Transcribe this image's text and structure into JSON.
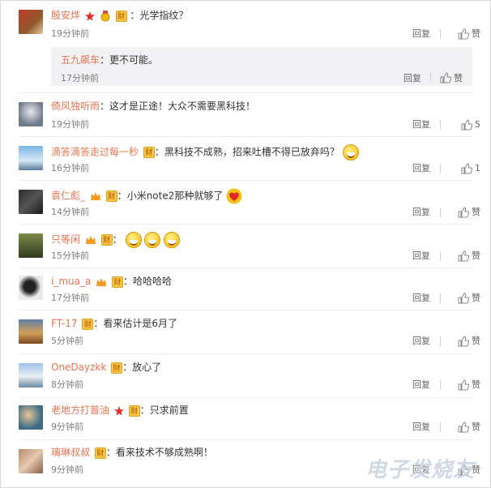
{
  "comments": [
    {
      "user": "殷安烨",
      "text": "光学指纹？",
      "time": "19分钟前",
      "reply": "回复",
      "like": "赞",
      "badges": [
        "vip-red",
        "medal",
        "cai"
      ],
      "sub": {
        "user": "五九飙车",
        "text": "更不可能。",
        "time": "17分钟前",
        "reply": "回复",
        "like": "赞"
      }
    },
    {
      "user": "倚风独听雨",
      "text": "这才是正途！大众不需要黑科技！",
      "time": "19分钟前",
      "reply": "回复",
      "like": "5",
      "badges": []
    },
    {
      "user": "滴答滴答走过每一秒",
      "text": "黑科技不成熟，招来吐槽不得已放弃吗？",
      "time": "16分钟前",
      "reply": "回复",
      "like": "1",
      "badges": [
        "cai"
      ],
      "emoji": [
        "laugh"
      ]
    },
    {
      "user": "袁仁彪_",
      "text": "小米note2那种就够了",
      "time": "14分钟前",
      "reply": "回复",
      "like": "赞",
      "badges": [
        "vip-orange",
        "cai"
      ],
      "emoji": [
        "heart"
      ]
    },
    {
      "user": "只等闲",
      "text": "",
      "time": "15分钟前",
      "reply": "回复",
      "like": "赞",
      "badges": [
        "vip-orange",
        "cai"
      ],
      "emoji": [
        "laugh",
        "laugh",
        "laugh"
      ]
    },
    {
      "user": "i_mua_a",
      "text": "哈哈哈哈",
      "time": "17分钟前",
      "reply": "回复",
      "like": "赞",
      "badges": [
        "vip-orange",
        "cai"
      ]
    },
    {
      "user": "FT-17",
      "text": "看来估计是6月了",
      "time": "5分钟前",
      "reply": "回复",
      "like": "赞",
      "badges": [
        "cai"
      ]
    },
    {
      "user": "OneDayzkk",
      "text": "放心了",
      "time": "8分钟前",
      "reply": "回复",
      "like": "赞",
      "badges": [
        "cai"
      ]
    },
    {
      "user": "老地方打普油",
      "text": "只求前置",
      "time": "9分钟前",
      "reply": "回复",
      "like": "赞",
      "badges": [
        "vip-red",
        "cai"
      ]
    },
    {
      "user": "璃琳叔叔",
      "text": "看来技术不够成熟啊！",
      "time": "9分钟前",
      "reply": "回复",
      "like": "赞",
      "badges": [
        "cai"
      ]
    }
  ],
  "labels": {
    "cai": "财",
    "colon": "："
  },
  "watermark": "电子发烧友",
  "colors": {
    "username": "#eb7350",
    "time": "#808080",
    "badge": "#f7c443"
  }
}
